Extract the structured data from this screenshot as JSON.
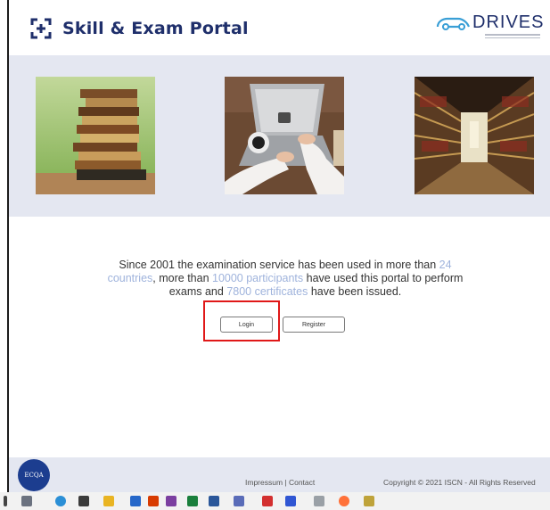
{
  "header": {
    "title": "Skill & Exam Portal",
    "partner_logo": "DRIVES"
  },
  "images": [
    {
      "name": "books-stack-photo"
    },
    {
      "name": "laptop-photo"
    },
    {
      "name": "library-photo"
    }
  ],
  "main": {
    "desc_part1": "Since 2001 the examination service has been used in more than ",
    "countries_count": "24",
    "desc_part2a": "countries",
    "desc_part2b": ", more than ",
    "participants_count": "10000 participants",
    "desc_part3": " have used this portal to perform exams and ",
    "certificates_count": "7800 certificates",
    "desc_part4": " have been issued.",
    "login_label": "Login",
    "register_label": "Register"
  },
  "footer": {
    "logo_text": "ECQA",
    "links": "Impressum | Contact",
    "copyright": "Copyright © 2021 ISCN - All Rights Reserved"
  },
  "colors": {
    "brand": "#1f2f6b",
    "band": "#e4e7f1",
    "highlight": "#9fb3dc",
    "annotation": "#e01818"
  }
}
